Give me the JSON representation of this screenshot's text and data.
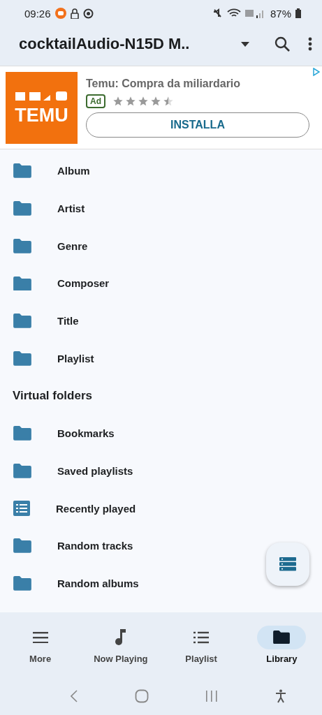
{
  "status_bar": {
    "time": "09:26",
    "battery": "87%"
  },
  "app_bar": {
    "title": "cocktailAudio-N15D M.."
  },
  "ad": {
    "title": "Temu: Compra da miliardario",
    "logo_text": "TEMU",
    "badge": "Ad",
    "stars": 4.5,
    "button": "INSTALLA"
  },
  "sections": [
    {
      "items": [
        {
          "label": "Album",
          "kind": "folder"
        },
        {
          "label": "Artist",
          "kind": "folder"
        },
        {
          "label": "Genre",
          "kind": "folder"
        },
        {
          "label": "Composer",
          "kind": "folder"
        },
        {
          "label": "Title",
          "kind": "folder"
        },
        {
          "label": "Playlist",
          "kind": "folder"
        }
      ]
    },
    {
      "heading": "Virtual folders",
      "items": [
        {
          "label": "Bookmarks",
          "kind": "folder"
        },
        {
          "label": "Saved playlists",
          "kind": "folder"
        },
        {
          "label": "Recently played",
          "kind": "list"
        },
        {
          "label": "Random tracks",
          "kind": "folder"
        },
        {
          "label": "Random albums",
          "kind": "folder"
        }
      ]
    }
  ],
  "bottom_nav": [
    {
      "label": "More",
      "kind": "menu",
      "selected": false
    },
    {
      "label": "Now Playing",
      "kind": "note",
      "selected": false
    },
    {
      "label": "Playlist",
      "kind": "list",
      "selected": false
    },
    {
      "label": "Library",
      "kind": "folder",
      "selected": true
    }
  ]
}
